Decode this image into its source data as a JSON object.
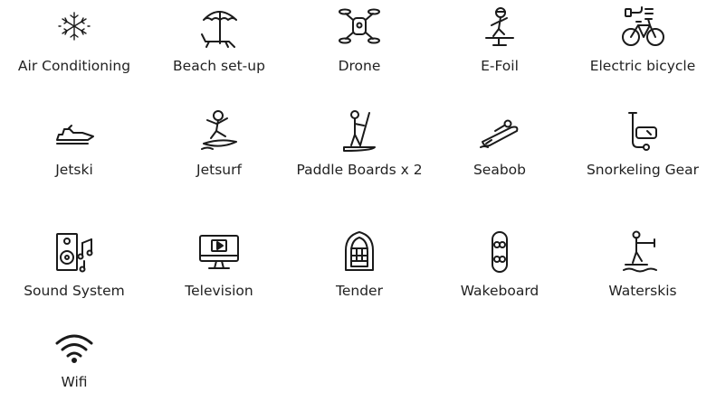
{
  "amenities": [
    {
      "label": "Air Conditioning",
      "icon": "snowflake-icon"
    },
    {
      "label": "Beach set-up",
      "icon": "beach-umbrella-icon"
    },
    {
      "label": "Drone",
      "icon": "drone-icon"
    },
    {
      "label": "E-Foil",
      "icon": "efoil-icon"
    },
    {
      "label": "Electric bicycle",
      "icon": "electric-bicycle-icon"
    },
    {
      "label": "Jetski",
      "icon": "jetski-icon"
    },
    {
      "label": "Jetsurf",
      "icon": "jetsurf-icon"
    },
    {
      "label": "Paddle Boards x 2",
      "icon": "paddle-board-icon"
    },
    {
      "label": "Seabob",
      "icon": "seabob-icon"
    },
    {
      "label": "Snorkeling Gear",
      "icon": "snorkel-icon"
    },
    {
      "label": "Sound System",
      "icon": "speaker-icon"
    },
    {
      "label": "Television",
      "icon": "television-icon"
    },
    {
      "label": "Tender",
      "icon": "tender-icon"
    },
    {
      "label": "Wakeboard",
      "icon": "wakeboard-icon"
    },
    {
      "label": "Waterskis",
      "icon": "waterskis-icon"
    },
    {
      "label": "Wifi",
      "icon": "wifi-icon"
    }
  ]
}
